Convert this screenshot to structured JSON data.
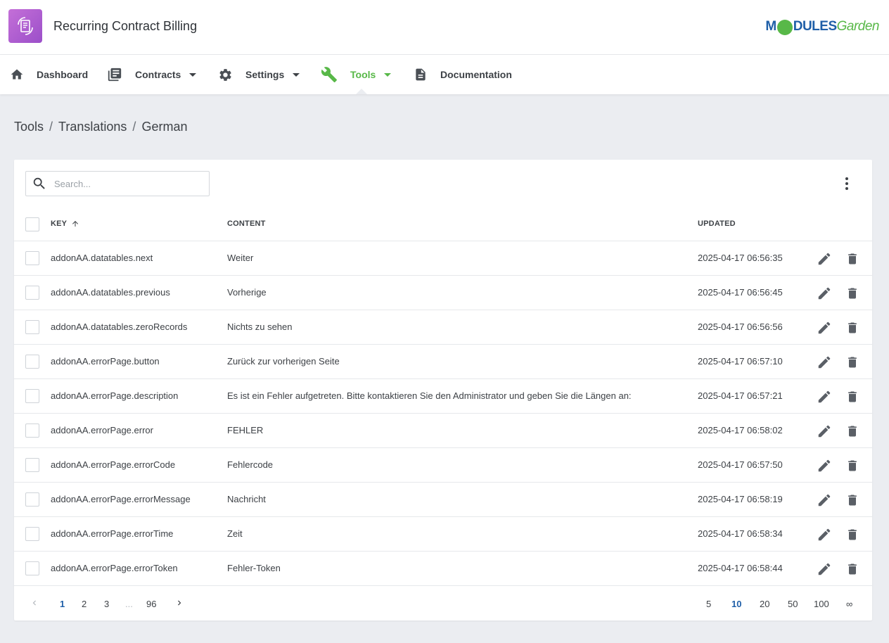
{
  "app": {
    "title": "Recurring Contract Billing",
    "brand_part1": "M",
    "brand_part2": "DULES",
    "brand_part3": "Garden"
  },
  "nav": [
    {
      "label": "Dashboard",
      "icon": "home-icon"
    },
    {
      "label": "Contracts",
      "icon": "contracts-icon"
    },
    {
      "label": "Settings",
      "icon": "gear-icon"
    },
    {
      "label": "Tools",
      "icon": "wrench-icon",
      "active": true
    },
    {
      "label": "Documentation",
      "icon": "document-icon"
    }
  ],
  "breadcrumb": [
    "Tools",
    "Translations",
    "German"
  ],
  "search": {
    "placeholder": "Search..."
  },
  "table": {
    "headers": {
      "key": "KEY",
      "content": "CONTENT",
      "updated": "UPDATED"
    },
    "rows": [
      {
        "key": "addonAA.datatables.next",
        "content": "Weiter",
        "updated": "2025-04-17 06:56:35"
      },
      {
        "key": "addonAA.datatables.previous",
        "content": "Vorherige",
        "updated": "2025-04-17 06:56:45"
      },
      {
        "key": "addonAA.datatables.zeroRecords",
        "content": "Nichts zu sehen",
        "updated": "2025-04-17 06:56:56"
      },
      {
        "key": "addonAA.errorPage.button",
        "content": "Zurück zur vorherigen Seite",
        "updated": "2025-04-17 06:57:10"
      },
      {
        "key": "addonAA.errorPage.description",
        "content": "Es ist ein Fehler aufgetreten. Bitte kontaktieren Sie den Administrator und geben Sie die Längen an:",
        "updated": "2025-04-17 06:57:21"
      },
      {
        "key": "addonAA.errorPage.error",
        "content": "FEHLER",
        "updated": "2025-04-17 06:58:02"
      },
      {
        "key": "addonAA.errorPage.errorCode",
        "content": "Fehlercode",
        "updated": "2025-04-17 06:57:50"
      },
      {
        "key": "addonAA.errorPage.errorMessage",
        "content": "Nachricht",
        "updated": "2025-04-17 06:58:19"
      },
      {
        "key": "addonAA.errorPage.errorTime",
        "content": "Zeit",
        "updated": "2025-04-17 06:58:34"
      },
      {
        "key": "addonAA.errorPage.errorToken",
        "content": "Fehler-Token",
        "updated": "2025-04-17 06:58:44"
      }
    ]
  },
  "pagination": {
    "pages": [
      "1",
      "2",
      "3",
      "...",
      "96"
    ],
    "current": "1"
  },
  "page_size": {
    "options": [
      "5",
      "10",
      "20",
      "50",
      "100",
      "∞"
    ],
    "selected": "10"
  },
  "colors": {
    "accent": "#58b848",
    "brand_blue": "#1f5fa8",
    "app_icon": "#b05fd3"
  }
}
